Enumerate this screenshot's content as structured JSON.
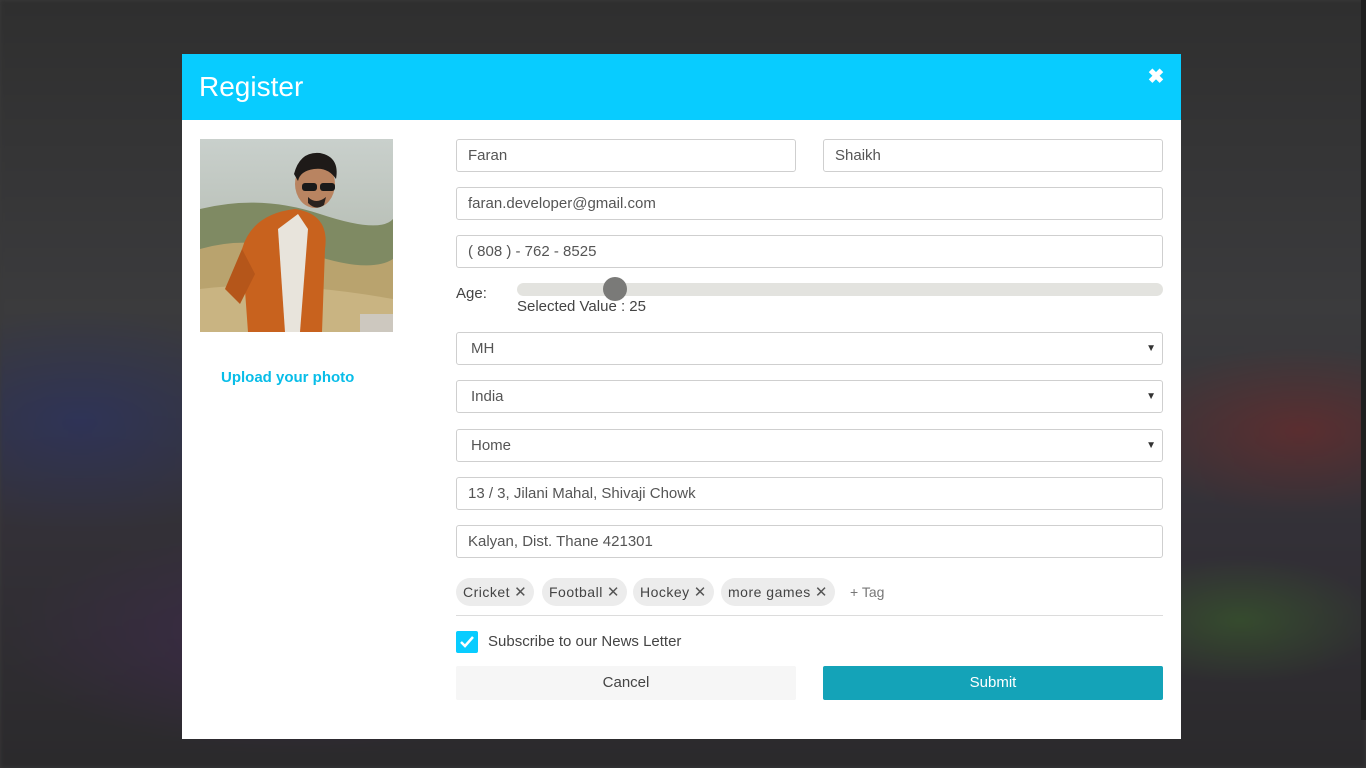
{
  "modal": {
    "title": "Register",
    "close_icon": "close-icon"
  },
  "profile": {
    "upload_label": "Upload your photo"
  },
  "form": {
    "first_name": "Faran",
    "last_name": "Shaikh",
    "email": "faran.developer@gmail.com",
    "phone": "( 808 ) - 762 - 8525",
    "age": {
      "label": "Age:",
      "value": 25,
      "value_text": "Selected Value : 25"
    },
    "state": "MH",
    "country": "India",
    "address_type": "Home",
    "address_line1": "13 / 3, Jilani Mahal, Shivaji Chowk",
    "address_line2": "Kalyan, Dist. Thane 421301",
    "tags": [
      "Cricket",
      "Football",
      "Hockey",
      "more games"
    ],
    "add_tag_label": "+ Tag",
    "newsletter": {
      "label": "Subscribe to our News Letter",
      "checked": true
    }
  },
  "actions": {
    "cancel_label": "Cancel",
    "submit_label": "Submit"
  },
  "colors": {
    "header": "#08ccff",
    "submit": "#14a3b8",
    "link": "#08bde8"
  }
}
